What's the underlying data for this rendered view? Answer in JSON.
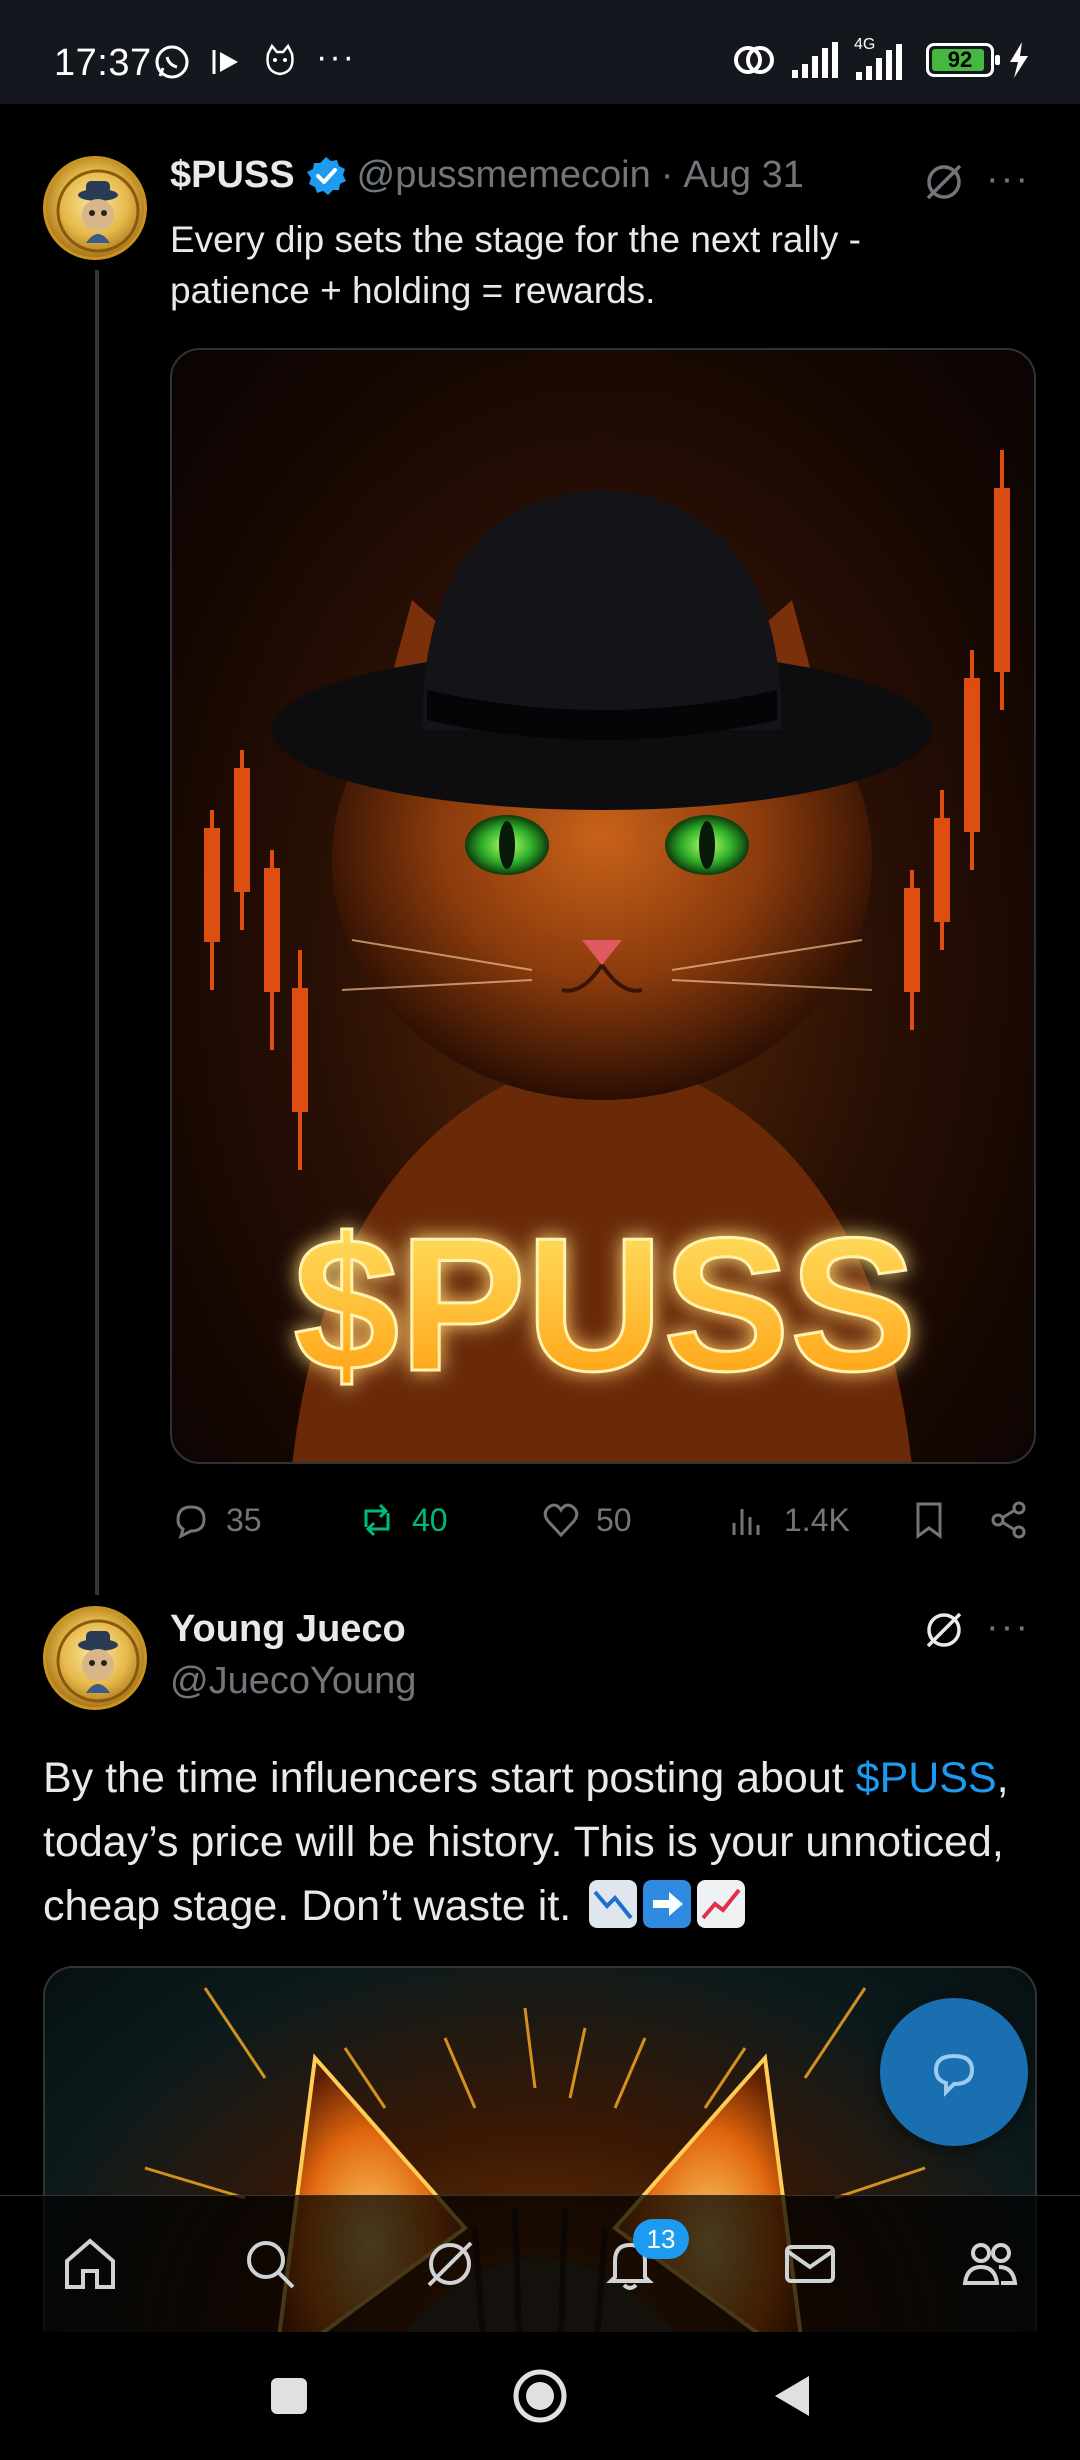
{
  "status_bar": {
    "time": "17:37",
    "network_label": "4G",
    "battery": "92",
    "battery_level": 0.92,
    "overflow": "···"
  },
  "tweet1": {
    "display_name": "$PUSS",
    "handle": "@pussmemecoin",
    "separator": "·",
    "date": "Aug 31",
    "text_line1": "Every dip sets the stage for the next rally -",
    "text_line2": "patience + holding = rewards.",
    "image_text": "$PUSS",
    "replies": "35",
    "reposts": "40",
    "likes": "50",
    "views": "1.4K"
  },
  "tweet2": {
    "display_name": "Young Jueco",
    "handle": "@JuecoYoung",
    "text_before": "By the time influencers start posting about ",
    "cashtag": "$PUSS",
    "text_after": ", today’s price will be history. This is your unnoticed, cheap stage. Don’t waste it."
  },
  "more_label": "···",
  "bottom_nav": {
    "notifications_badge": "13"
  },
  "colors": {
    "accent": "#1d9bf0",
    "repost_active": "#00ba7c",
    "muted": "#71767b",
    "glow": "#ffc21a"
  }
}
